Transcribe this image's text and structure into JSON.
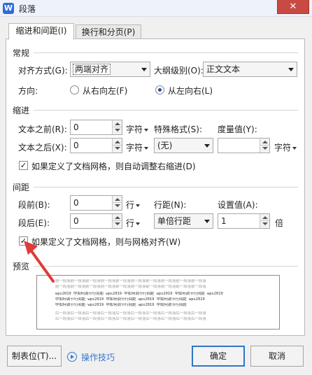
{
  "window": {
    "title": "段落",
    "app_icon": "W",
    "close_label": "✕"
  },
  "tabs": [
    {
      "label": "缩进和间距(I)",
      "active": true
    },
    {
      "label": "换行和分页(P)",
      "active": false
    }
  ],
  "general": {
    "heading": "常规",
    "alignment_label": "对齐方式(G):",
    "alignment_value": "两端对齐",
    "outline_label": "大纲级别(O):",
    "outline_value": "正文文本",
    "direction_label": "方向:",
    "rtl_label": "从右向左(F)",
    "ltr_label": "从左向右(L)",
    "direction_selected": "ltr"
  },
  "indent": {
    "heading": "缩进",
    "before_label": "文本之前(R):",
    "before_value": "0",
    "before_unit": "字符",
    "after_label": "文本之后(X):",
    "after_value": "0",
    "after_unit": "字符",
    "special_label": "特殊格式(S):",
    "special_value": "(无)",
    "measure_label": "度量值(Y):",
    "measure_value": "",
    "measure_unit": "字符",
    "auto_adjust_label": "如果定义了文档网格，则自动调整右缩进(D)",
    "auto_adjust_checked": true
  },
  "spacing": {
    "heading": "间距",
    "before_label": "段前(B):",
    "before_value": "0",
    "before_unit": "行",
    "after_label": "段后(E):",
    "after_value": "0",
    "after_unit": "行",
    "line_label": "行距(N):",
    "line_value": "单倍行距",
    "setting_label": "设置值(A):",
    "setting_value": "1",
    "setting_unit": "倍",
    "snap_label": "如果定义了文档网格，则与网格对齐(W)",
    "snap_checked": true
  },
  "preview": {
    "heading": "预览",
    "lines_before": [
      "前一段落前一段落前一段落前一段落前一段落前一段落前一段落前一段落前一段落前一段落",
      "前一段落前一段落前一段落前一段落前一段落前一段落前一段落前一段落前一段落前一段落"
    ],
    "lines_sample": [
      "wps2019 中如何调节行间距 wps2019 中如何调节行间距 wps2019 中如何调节行间距 wps2019",
      "中如何调节行间距 wps2019 中如何调节行间距 wps2019 中如何调节行间距 wps2019",
      "中如何调节行间距 wps2019 中如何调节行间距 wps2019 中如何调节行间距"
    ],
    "lines_after": [
      "后一段落后一段落后一段落后一段落后一段落后一段落后一段落后一段落后一段落后一段落",
      "后一段落后一段落后一段落后一段落后一段落后一段落后一段落后一段落后一段落后一段落"
    ]
  },
  "footer": {
    "tabs_button": "制表位(T)...",
    "tips_link": "操作技巧",
    "ok_button": "确定",
    "cancel_button": "取消"
  },
  "colors": {
    "accent": "#2e74c9",
    "close": "#c94a42",
    "annotation": "#e03a3a"
  }
}
